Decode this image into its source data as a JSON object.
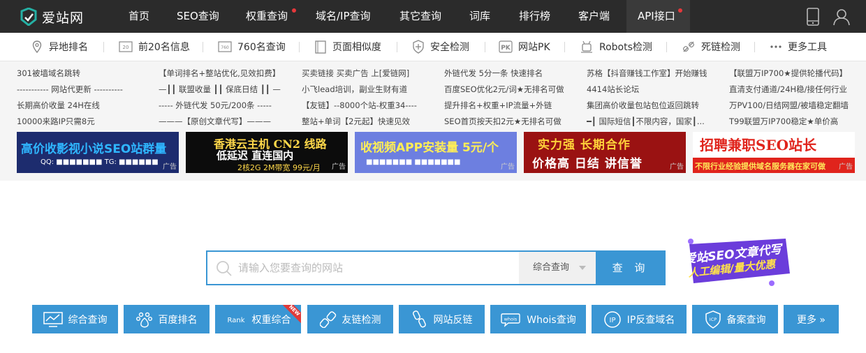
{
  "logo": {
    "text": "爱站网"
  },
  "nav": [
    {
      "label": "首页"
    },
    {
      "label": "SEO查询"
    },
    {
      "label": "权重查询"
    },
    {
      "label": "域名/IP查询"
    },
    {
      "label": "其它查询"
    },
    {
      "label": "词库"
    },
    {
      "label": "排行榜"
    },
    {
      "label": "客户端"
    },
    {
      "label": "API接口"
    }
  ],
  "tools": [
    {
      "label": "异地排名",
      "icon": "location-icon"
    },
    {
      "label": "前20名信息",
      "icon": "top20-icon"
    },
    {
      "label": "760名查询",
      "icon": "top760-icon"
    },
    {
      "label": "页面相似度",
      "icon": "page-similarity-icon"
    },
    {
      "label": "安全检测",
      "icon": "shield-icon"
    },
    {
      "label": "网站PK",
      "icon": "pk-icon"
    },
    {
      "label": "Robots检测",
      "icon": "robot-icon"
    },
    {
      "label": "死链检测",
      "icon": "broken-link-icon"
    },
    {
      "label": "更多工具",
      "icon": "more-icon"
    }
  ],
  "promo_links": [
    [
      "301被墙域名跳转",
      "----------- 网站代更新 ----------",
      "长期高价收量 24H在线",
      "10000来路IP只需8元"
    ],
    [
      "【单词排名+整站优化,见效扣费】",
      "—┃┃ 联盟收量 ┃┃ 保底日结 ┃┃ —",
      "----- 外链代发 50元/200条 -----",
      "———【原创文章代写】———"
    ],
    [
      "买卖链接 买卖广告 上[爱链网]",
      "小飞lead培训，副业生财有道",
      "【友链】--8000个站-权重34----",
      "整站+单词【2元起】快速见效"
    ],
    [
      "外链代发 5分一条 快速排名",
      "百度SEO优化2元/词★无排名可做",
      "提升排名+权重+IP流量+外链",
      "SEO首页按天扣2元★无排名可做"
    ],
    [
      "苏格【抖音赚钱工作室】开始赚钱",
      "4414站长论坛",
      "集团高价收量包站包位返回跳转",
      "━┃ 国际短信┃不限内容，国家┃..."
    ],
    [
      "【联盟万IP700★提供轮播代码】",
      "直清支付通道/24H稳/接任何行业",
      "万PV100/日结网盟/被墙稳定翻墙",
      "T99联盟万IP700稳定★单价高"
    ]
  ],
  "banners": [
    {
      "title": "高价收影视小说SEO站群量",
      "sub": "QQ: ■■■■■■■  TG: ■■■■■■",
      "tag": "广告",
      "bg": "#1d2c6e",
      "color": "#2fb6ff"
    },
    {
      "title": "香港云主机 CN2 线路",
      "sub": "低延迟 直连国内",
      "sub2": "2核2G 2M带宽 99元/月",
      "tag": "广告",
      "bg": "#0c0c0c",
      "color": "#ffd84a"
    },
    {
      "title": "收视频APP安装量 5元/个",
      "sub": "■■■■■■■  ■■■■■■■",
      "tag": "广告",
      "bg": "#6d7fe0",
      "color": "#ffee55"
    },
    {
      "title": "实力强 长期合作",
      "sub": "价格高 日结 讲信誉",
      "tag": "广告",
      "bg": "#9a1212",
      "color": "#ffd23a"
    },
    {
      "title": "招聘兼职SEO站长",
      "sub": "不限行业经验提供域名服务器在家可做",
      "tag": "广告",
      "bg": "#ffffff",
      "color": "#e0241c"
    }
  ],
  "search": {
    "placeholder": "请输入您要查询的网站",
    "select_value": "综合查询",
    "button_label": "查 询"
  },
  "side_badge": {
    "line1": "爱站SEO文章代写",
    "line2": "人工编辑/量大优惠"
  },
  "quick_buttons": [
    {
      "label": "综合查询",
      "icon": "chart-monitor-icon"
    },
    {
      "label": "百度排名",
      "icon": "baidu-paw-icon"
    },
    {
      "label": "权重综合",
      "icon": "rank-icon",
      "icon_text": "Rank",
      "ribbon": "NEW"
    },
    {
      "label": "友链检测",
      "icon": "link-icon"
    },
    {
      "label": "网站反链",
      "icon": "backlink-icon"
    },
    {
      "label": "Whois查询",
      "icon": "whois-icon",
      "icon_text": "whois"
    },
    {
      "label": "IP反查域名",
      "icon": "ip-icon",
      "icon_text": "IP"
    },
    {
      "label": "备案查询",
      "icon": "icp-shield-icon",
      "icon_text": "ICP"
    },
    {
      "label": "更多 »",
      "icon": ""
    }
  ],
  "colors": {
    "accent": "#3a96d4",
    "nav_bg": "#2b2b2b",
    "red_dot": "#e5383b"
  }
}
